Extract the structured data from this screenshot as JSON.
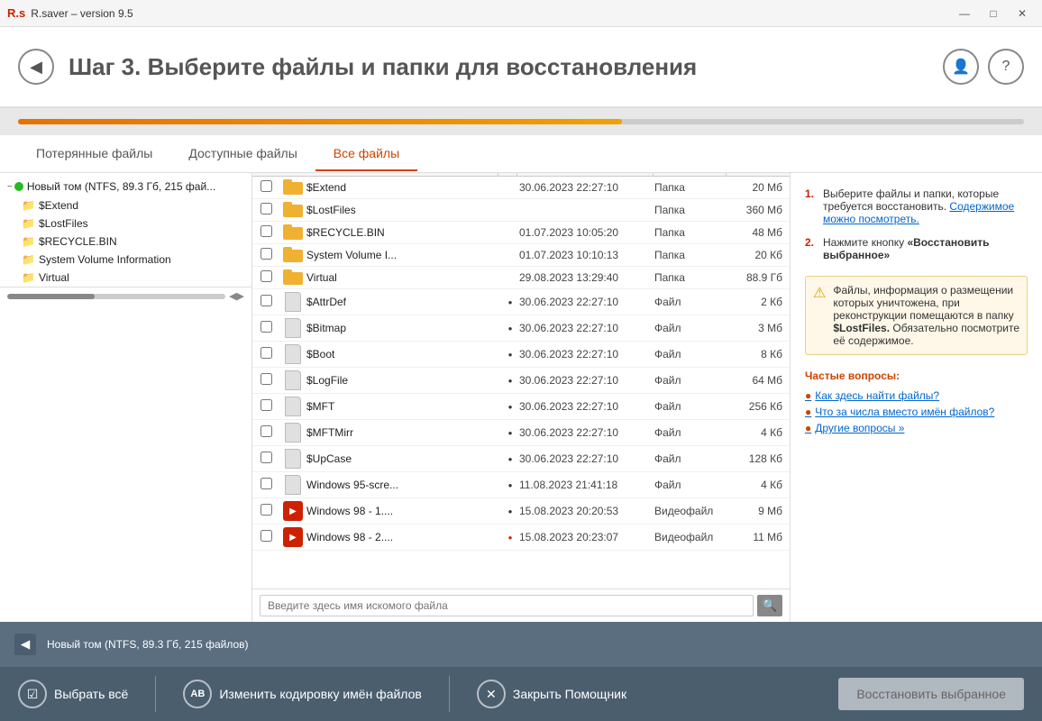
{
  "window": {
    "title": "R.saver  –  version 9.5",
    "logo": "R.s"
  },
  "titlebar_controls": {
    "minimize": "—",
    "maximize": "□",
    "close": "✕"
  },
  "header": {
    "step": "Шаг 3.",
    "title": " Выберите файлы и папки для восстановления"
  },
  "tabs": [
    {
      "label": "Потерянные файлы",
      "active": false
    },
    {
      "label": "Доступные файлы",
      "active": false
    },
    {
      "label": "Все файлы",
      "active": true
    }
  ],
  "tree": {
    "root_label": "Новый том (NTFS, 89.3 Гб, 215 фай...",
    "items": [
      {
        "label": "$Extend",
        "indent": 1
      },
      {
        "label": "$LostFiles",
        "indent": 1
      },
      {
        "label": "$RECYCLE.BIN",
        "indent": 1
      },
      {
        "label": "System Volume Information",
        "indent": 1
      },
      {
        "label": "Virtual",
        "indent": 1
      }
    ]
  },
  "files": [
    {
      "name": "$Extend",
      "date": "30.06.2023 22:27:10",
      "type": "Папка",
      "size": "20 Мб",
      "icon": "folder",
      "dot": null
    },
    {
      "name": "$LostFiles",
      "date": "",
      "type": "Папка",
      "size": "360 Мб",
      "icon": "folder",
      "dot": null
    },
    {
      "name": "$RECYCLE.BIN",
      "date": "01.07.2023 10:05:20",
      "type": "Папка",
      "size": "48 Мб",
      "icon": "folder",
      "dot": null
    },
    {
      "name": "System Volume I...",
      "date": "01.07.2023 10:10:13",
      "type": "Папка",
      "size": "20 Кб",
      "icon": "folder",
      "dot": null
    },
    {
      "name": "Virtual",
      "date": "29.08.2023 13:29:40",
      "type": "Папка",
      "size": "88.9 Гб",
      "icon": "folder",
      "dot": null
    },
    {
      "name": "$AttrDef",
      "date": "30.06.2023 22:27:10",
      "type": "Файл",
      "size": "2 Кб",
      "icon": "file",
      "dot": "black"
    },
    {
      "name": "$Bitmap",
      "date": "30.06.2023 22:27:10",
      "type": "Файл",
      "size": "3 Мб",
      "icon": "file",
      "dot": "black"
    },
    {
      "name": "$Boot",
      "date": "30.06.2023 22:27:10",
      "type": "Файл",
      "size": "8 Кб",
      "icon": "file",
      "dot": "black"
    },
    {
      "name": "$LogFile",
      "date": "30.06.2023 22:27:10",
      "type": "Файл",
      "size": "64 Мб",
      "icon": "file",
      "dot": "black"
    },
    {
      "name": "$MFT",
      "date": "30.06.2023 22:27:10",
      "type": "Файл",
      "size": "256 Кб",
      "icon": "file",
      "dot": "black"
    },
    {
      "name": "$MFTMirr",
      "date": "30.06.2023 22:27:10",
      "type": "Файл",
      "size": "4 Кб",
      "icon": "file",
      "dot": "black"
    },
    {
      "name": "$UpCase",
      "date": "30.06.2023 22:27:10",
      "type": "Файл",
      "size": "128 Кб",
      "icon": "file",
      "dot": "black"
    },
    {
      "name": "Windows 95-scre...",
      "date": "11.08.2023 21:41:18",
      "type": "Файл",
      "size": "4 Кб",
      "icon": "file",
      "dot": "black"
    },
    {
      "name": "Windows 98 - 1....",
      "date": "15.08.2023 20:20:53",
      "type": "Видеофайл",
      "size": "9 Мб",
      "icon": "video",
      "dot": "black"
    },
    {
      "name": "Windows 98 - 2....",
      "date": "15.08.2023 20:23:07",
      "type": "Видеофайл",
      "size": "11 Мб",
      "icon": "video",
      "dot": "red"
    }
  ],
  "search": {
    "placeholder": "Введите здесь имя искомого файла"
  },
  "info": {
    "tip1_a": "Выберите файлы и папки, которые требуется восстановить. ",
    "tip1_b": "Содержимое можно посмотреть.",
    "tip2_a": "Нажмите кнопку ",
    "tip2_b": "«Восстановить выбранное»",
    "warning": "Файлы, информация о размещении которых уничтожена, при реконструкции помещаются в папку ",
    "warning_link": "$LostFiles.",
    "warning_end": " Обязательно посмотрите её содержимое.",
    "faq_title": "Частые вопросы:",
    "faq_items": [
      "Как здесь найти файлы?",
      "Что за числа вместо имён файлов?",
      "Другие вопросы »"
    ]
  },
  "status_bar": {
    "text": "Новый том (NTFS, 89.3 Гб, 215 файлов)"
  },
  "toolbar": {
    "select_all": "Выбрать всё",
    "change_encoding": "Изменить кодировку имён файлов",
    "close_wizard": "Закрыть Помощник",
    "restore": "Восстановить выбранное"
  }
}
